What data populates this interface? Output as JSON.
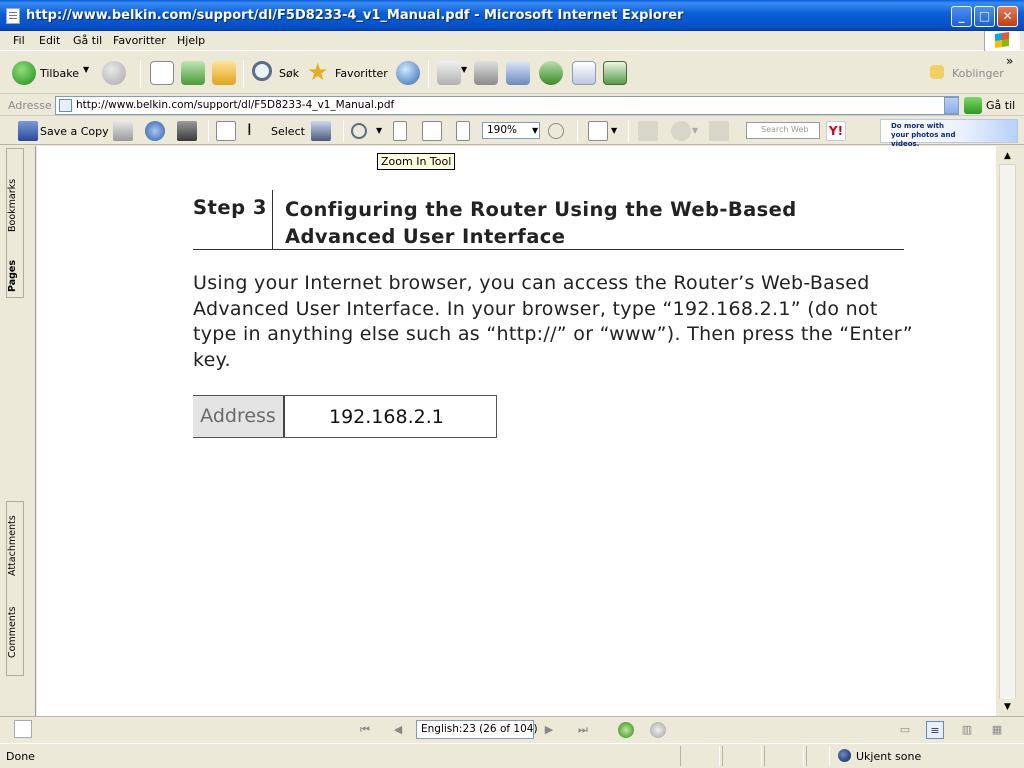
{
  "window": {
    "title": "http://www.belkin.com/support/dl/F5D8233-4_v1_Manual.pdf - Microsoft Internet Explorer",
    "controls": {
      "minimize": "_",
      "maximize": "□",
      "close": "✕"
    }
  },
  "menu": [
    "Fil",
    "Edit",
    "Gå til",
    "Favoritter",
    "Hjelp"
  ],
  "toolbar": {
    "back_label": "Tilbake",
    "search_label": "Søk",
    "favorites_label": "Favoritter",
    "extra_label": "Koblinger",
    "more": "»"
  },
  "address": {
    "label": "Adresse",
    "url": "http://www.belkin.com/support/dl/F5D8233-4_v1_Manual.pdf",
    "go_label": "Gå til"
  },
  "acrobat": {
    "save_copy_label": "Save a Copy",
    "select_label": "Select",
    "zoom_value": "190%",
    "search_placeholder": "Search Web",
    "yahoo_label": "Y!",
    "ad_text": "Do more with your photos and videos."
  },
  "nav_panel": {
    "tabs": [
      "Bookmarks",
      "Pages",
      "Attachments",
      "Comments"
    ]
  },
  "document": {
    "tooltip": "Zoom In Tool",
    "step_label": "Step 3",
    "step_title": "Configuring the Router Using the Web-Based Advanced User Interface",
    "body": "Using your Internet browser, you can access the Router’s Web-Based Advanced User Interface. In your browser, type “192.168.2.1” (do not type in anything else such as “http://” or “www”). Then press the “Enter” key.",
    "address_label": "Address",
    "address_value": "192.168.2.1"
  },
  "pdf_status": {
    "page_display": "English:23  (26 of 104)"
  },
  "status": {
    "left": "Done",
    "zone": "Ukjent sone"
  }
}
